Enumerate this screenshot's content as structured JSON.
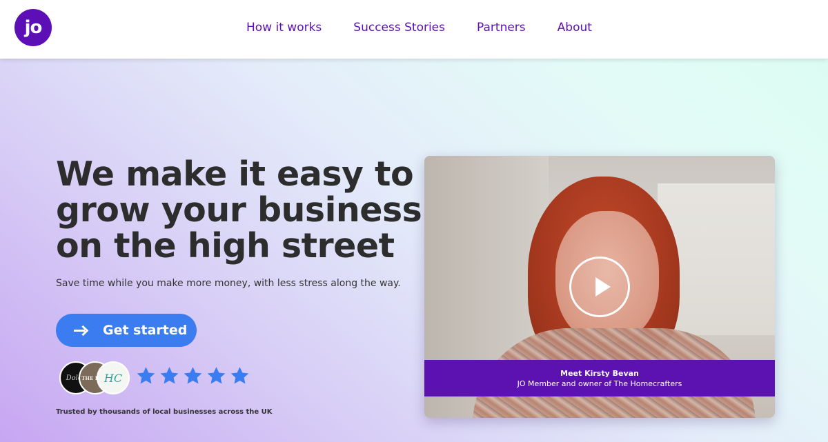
{
  "header": {
    "logo_text": "jo",
    "nav": [
      {
        "label": "How it works"
      },
      {
        "label": "Success Stories"
      },
      {
        "label": "Partners"
      },
      {
        "label": "About"
      }
    ]
  },
  "hero": {
    "headline_lines": [
      "We make it easy to",
      "grow your business",
      "on the high street"
    ],
    "subtext": "Save time while you make more money, with less stress along the way.",
    "cta_label": "Get started",
    "rating_stars": 5,
    "trust_text": "Trusted by thousands of local businesses across the UK",
    "logos": [
      {
        "icon": "business-logo-script",
        "text": "Dolce"
      },
      {
        "icon": "business-logo-kitchen",
        "text": "THE KITC"
      },
      {
        "icon": "business-logo-hc",
        "text": "HC"
      }
    ]
  },
  "video": {
    "caption_title": "Meet Kirsty Bevan",
    "caption_subtitle": "JO Member and owner of The Homecrafters",
    "play_icon": "play-icon"
  },
  "colors": {
    "brand_purple": "#5c0fb4",
    "cta_blue": "#3b7df0",
    "star_blue": "#3b7df0",
    "headline": "#2d2d2d"
  }
}
